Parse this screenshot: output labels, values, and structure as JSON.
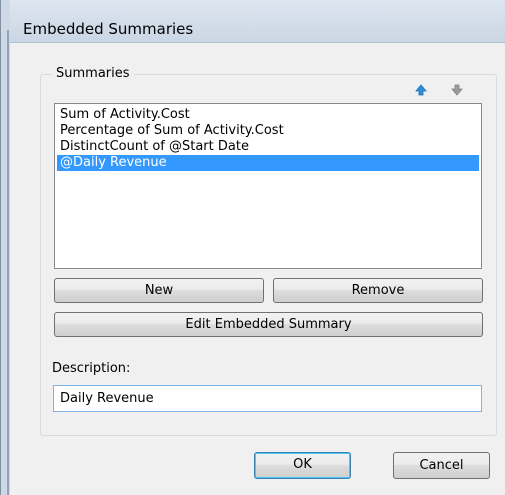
{
  "window": {
    "title": "Embedded Summaries"
  },
  "summaries": {
    "group_label": "Summaries",
    "move_up_icon": "arrow-up-icon",
    "move_down_icon": "arrow-down-icon",
    "items": [
      {
        "label": "Sum of Activity.Cost",
        "selected": false
      },
      {
        "label": "Percentage of Sum of Activity.Cost",
        "selected": false
      },
      {
        "label": "DistinctCount of @Start Date",
        "selected": false
      },
      {
        "label": "@Daily Revenue",
        "selected": true
      }
    ],
    "new_label": "New",
    "remove_label": "Remove",
    "edit_label": "Edit Embedded Summary"
  },
  "description": {
    "label": "Description:",
    "value": "Daily Revenue"
  },
  "footer": {
    "ok_label": "OK",
    "cancel_label": "Cancel"
  },
  "colors": {
    "selection": "#3399ff",
    "up_arrow": "#2f8fdc",
    "down_arrow": "#9a9a9a"
  }
}
